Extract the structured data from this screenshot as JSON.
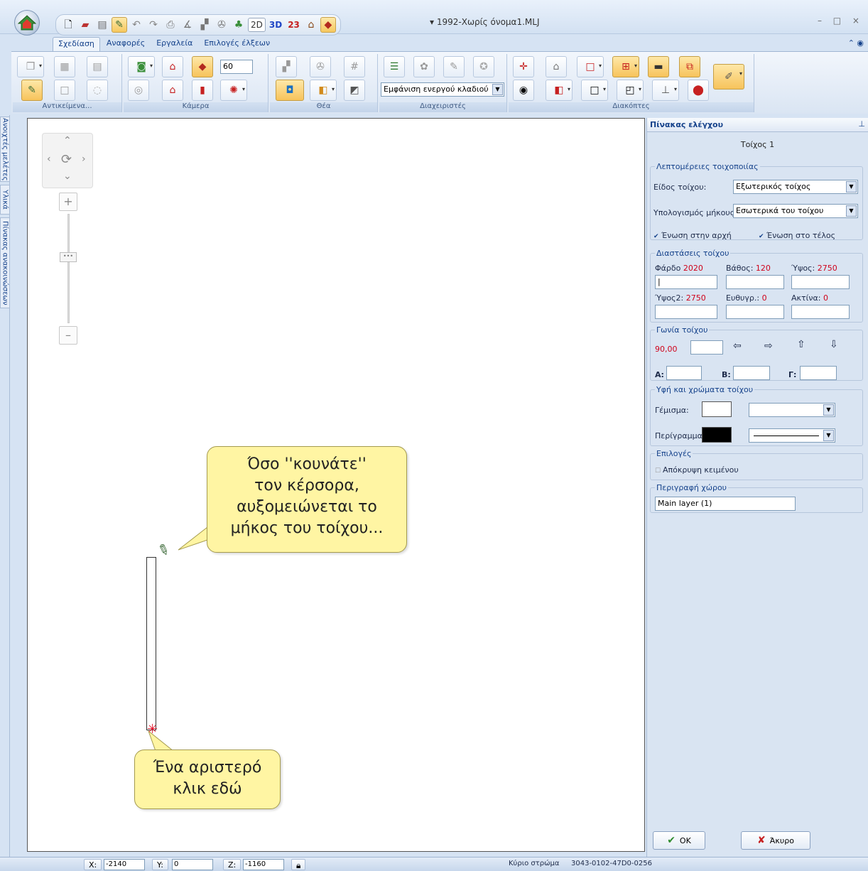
{
  "app": {
    "document_title": "1992-Χωρίς όνομα1.MLJ",
    "quick_access": {
      "mode_2d": "2D",
      "mode_3d": "3D",
      "mode_23": "23"
    }
  },
  "ribbon": {
    "tabs": [
      "Σχεδίαση",
      "Αναφορές",
      "Εργαλεία",
      "Επιλογές έλξεων"
    ],
    "active_tab": 0,
    "groups": {
      "objects": "Αντικείμενα...",
      "camera": "Κάμερα",
      "view": "Θέα",
      "managers": "Διαχειριστές",
      "switches": "Διακόπτες"
    },
    "camera_value": "60",
    "branch_combo": "Εμφάνιση ενεργού κλαδιού"
  },
  "side_tabs": [
    "Ανοιχτές μελέτες",
    "Υλικά",
    "Πίνακας ανακοινώσεων"
  ],
  "canvas": {
    "tip_1": "Όσο ''κουνάτε'' τον κέρσορα, αυξομειώνεται το μήκος του τοίχου...",
    "tip_1_lines": [
      "Όσο ''κουνάτε''",
      "τον κέρσορα,",
      "αυξομειώνεται το",
      "μήκος του τοίχου..."
    ],
    "tip_2_lines": [
      "Ένα αριστερό",
      "κλικ εδώ"
    ]
  },
  "panel": {
    "title": "Πίνακας ελέγχου",
    "subtitle": "Τοίχος 1",
    "wall_details": {
      "legend": "Λεπτομέρειες τοιχοποιίας",
      "type_label": "Είδος τοίχου:",
      "type_value": "Εξωτερικός τοίχος",
      "length_label": "Υπολογισμός μήκους:",
      "length_value": "Εσωτερικά του τοίχου",
      "join_start": "Ένωση στην αρχή",
      "join_end": "Ένωση στο τέλος"
    },
    "dimensions": {
      "legend": "Διαστάσεις τοίχου",
      "width_label": "Φάρδο",
      "width_value": "2020",
      "depth_label": "Βάθος:",
      "depth_value": "120",
      "height_label": "Ύψος:",
      "height_value": "2750",
      "height2_label": "Ύψος2:",
      "height2_value": "2750",
      "straight_label": "Ευθυγρ.:",
      "straight_value": "0",
      "radius_label": "Ακτίνα:",
      "radius_value": "0"
    },
    "angle": {
      "legend": "Γωνία τοίχου",
      "value": "90,00",
      "a_label": "Α:",
      "b_label": "Β:",
      "c_label": "Γ:"
    },
    "texture": {
      "legend": "Υφή και χρώματα τοίχου",
      "fill_label": "Γέμισμα:",
      "outline_label": "Περίγραμμα:",
      "fill_color": "#ffffff",
      "outline_color": "#000000"
    },
    "options": {
      "legend": "Επιλογές",
      "hide_text": "Απόκρυψη κειμένου"
    },
    "space": {
      "legend": "Περιγραφή χώρου",
      "value": "Main layer (1)"
    },
    "ok_label": "OK",
    "cancel_label": "Άκυρο"
  },
  "status": {
    "x_label": "X:",
    "x_value": "-2140",
    "y_label": "Y:",
    "y_value": "0",
    "z_label": "Z:",
    "z_value": "-1160",
    "layer_label": "Κύριο στρώμα",
    "code": "3043-0102-47D0-0256"
  }
}
